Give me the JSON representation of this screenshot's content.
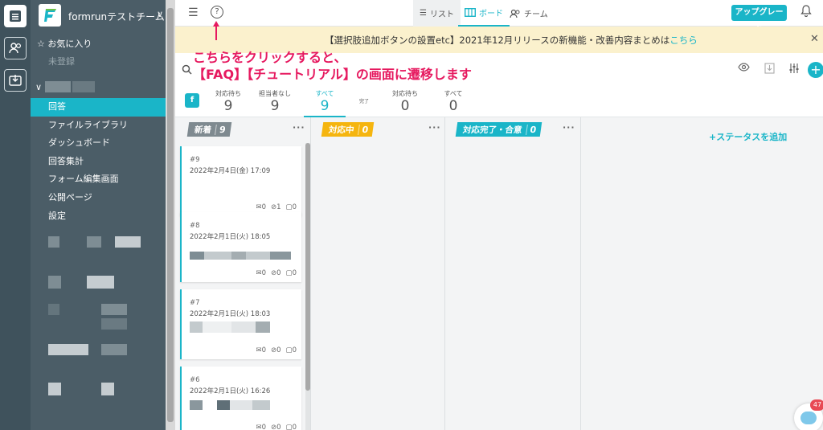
{
  "team": {
    "name": "formrunテストチーム"
  },
  "sidebar": {
    "favorites_label": "お気に入り",
    "unregistered_label": "未登録",
    "menu": [
      {
        "label": "回答",
        "active": true
      },
      {
        "label": "ファイルライブラリ"
      },
      {
        "label": "ダッシュボード"
      },
      {
        "label": "回答集計"
      },
      {
        "label": "フォーム編集画面"
      },
      {
        "label": "公開ページ"
      },
      {
        "label": "設定"
      }
    ]
  },
  "topbar": {
    "views": [
      {
        "label": "リスト",
        "icon": "list-icon"
      },
      {
        "label": "ボード",
        "icon": "board-icon",
        "active": true
      },
      {
        "label": "チーム",
        "icon": "team-icon"
      }
    ],
    "upgrade_label": "アップグレード"
  },
  "banner": {
    "text": "【選択肢追加ボタンの設置etc】2021年12月リリースの新機能・改善内容まとめは",
    "link": "こちら"
  },
  "annotation": {
    "line1": "こちらをクリックすると、",
    "line2": "【FAQ】【チュートリアル】の画面に遷移します"
  },
  "stats": [
    {
      "label": "対応待ち",
      "count": "9"
    },
    {
      "label": "担当者なし",
      "count": "9"
    },
    {
      "label": "すべて",
      "count": "9",
      "active": true
    },
    {
      "label": "完了",
      "count": ""
    },
    {
      "label": "対応待ち",
      "count": "0"
    },
    {
      "label": "すべて",
      "count": "0"
    }
  ],
  "columns": [
    {
      "title": "新着",
      "count": "9",
      "color": "#7f8a90"
    },
    {
      "title": "対応中",
      "count": "0",
      "color": "#f5b50f"
    },
    {
      "title": "対応完了・合意",
      "count": "0",
      "color": "#1ab5c8"
    }
  ],
  "add_status_label": "+ステータスを追加",
  "cards": [
    {
      "id": "#9",
      "date": "2022年2月4日(金) 17:09",
      "messages": "0",
      "attachments": "1",
      "comments": "0"
    },
    {
      "id": "#8",
      "date": "2022年2月1日(火) 18:05",
      "messages": "0",
      "attachments": "0",
      "comments": "0"
    },
    {
      "id": "#7",
      "date": "2022年2月1日(火) 18:03",
      "messages": "0",
      "attachments": "0",
      "comments": "0"
    },
    {
      "id": "#6",
      "date": "2022年2月1日(火) 16:26",
      "messages": "0",
      "attachments": "0",
      "comments": "0"
    }
  ],
  "chat": {
    "badge": "47"
  },
  "colors": {
    "accent": "#1ab5c8",
    "annotation": "#e6195f",
    "banner_bg": "#fbf1cd"
  }
}
